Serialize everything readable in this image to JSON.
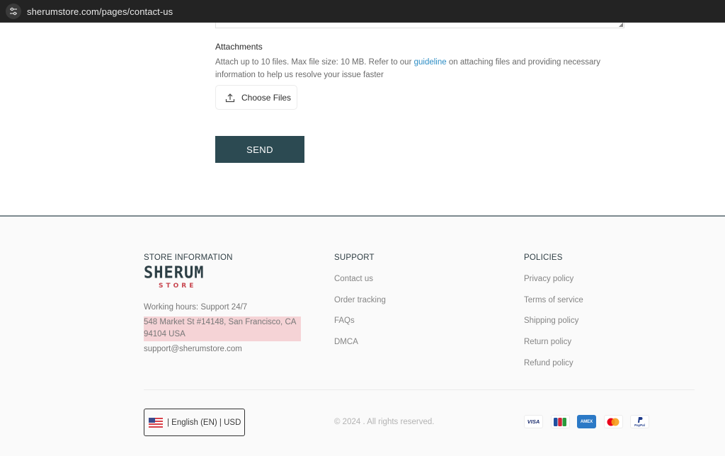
{
  "browser": {
    "url": "sherumstore.com/pages/contact-us",
    "site_icon": "tune-icon"
  },
  "form": {
    "attachments_title": "Attachments",
    "attachments_desc_before": "Attach up to 10 files. Max file size: 10 MB. Refer to our ",
    "attachments_link": "guideline",
    "attachments_desc_after": " on attaching files and providing necessary information to help us resolve your issue faster",
    "choose_files_label": "Choose Files",
    "choose_files_icon": "upload-icon",
    "send_label": "SEND"
  },
  "footer": {
    "store": {
      "heading": "STORE INFORMATION",
      "logo_main": "SHERUM",
      "logo_sub": "STORE",
      "hours": "Working hours: Support 24/7",
      "address": "548 Market St #14148, San Francisco, CA 94104 USA",
      "email": "support@sherumstore.com"
    },
    "support": {
      "heading": "SUPPORT",
      "links": [
        "Contact us",
        "Order tracking",
        "FAQs",
        "DMCA"
      ]
    },
    "policies": {
      "heading": "POLICIES",
      "links": [
        "Privacy policy",
        "Terms of service",
        "Shipping policy",
        "Return policy",
        "Refund policy"
      ]
    },
    "locale": {
      "flag": "us-flag-icon",
      "label": "| English (EN) | USD"
    },
    "copyright": "© 2024 . All rights reserved.",
    "payments": [
      {
        "name": "visa",
        "label": "VISA"
      },
      {
        "name": "jcb",
        "label": "JCB"
      },
      {
        "name": "amex",
        "label": "AMEX"
      },
      {
        "name": "mastercard",
        "label": ""
      },
      {
        "name": "paypal",
        "label": "PayPal"
      }
    ]
  },
  "colors": {
    "send_button": "#2c4a52",
    "link": "#2b8cc4",
    "logo_main": "#2d3f45",
    "logo_sub": "#c8464f",
    "address_highlight": "#f5d3d6"
  }
}
